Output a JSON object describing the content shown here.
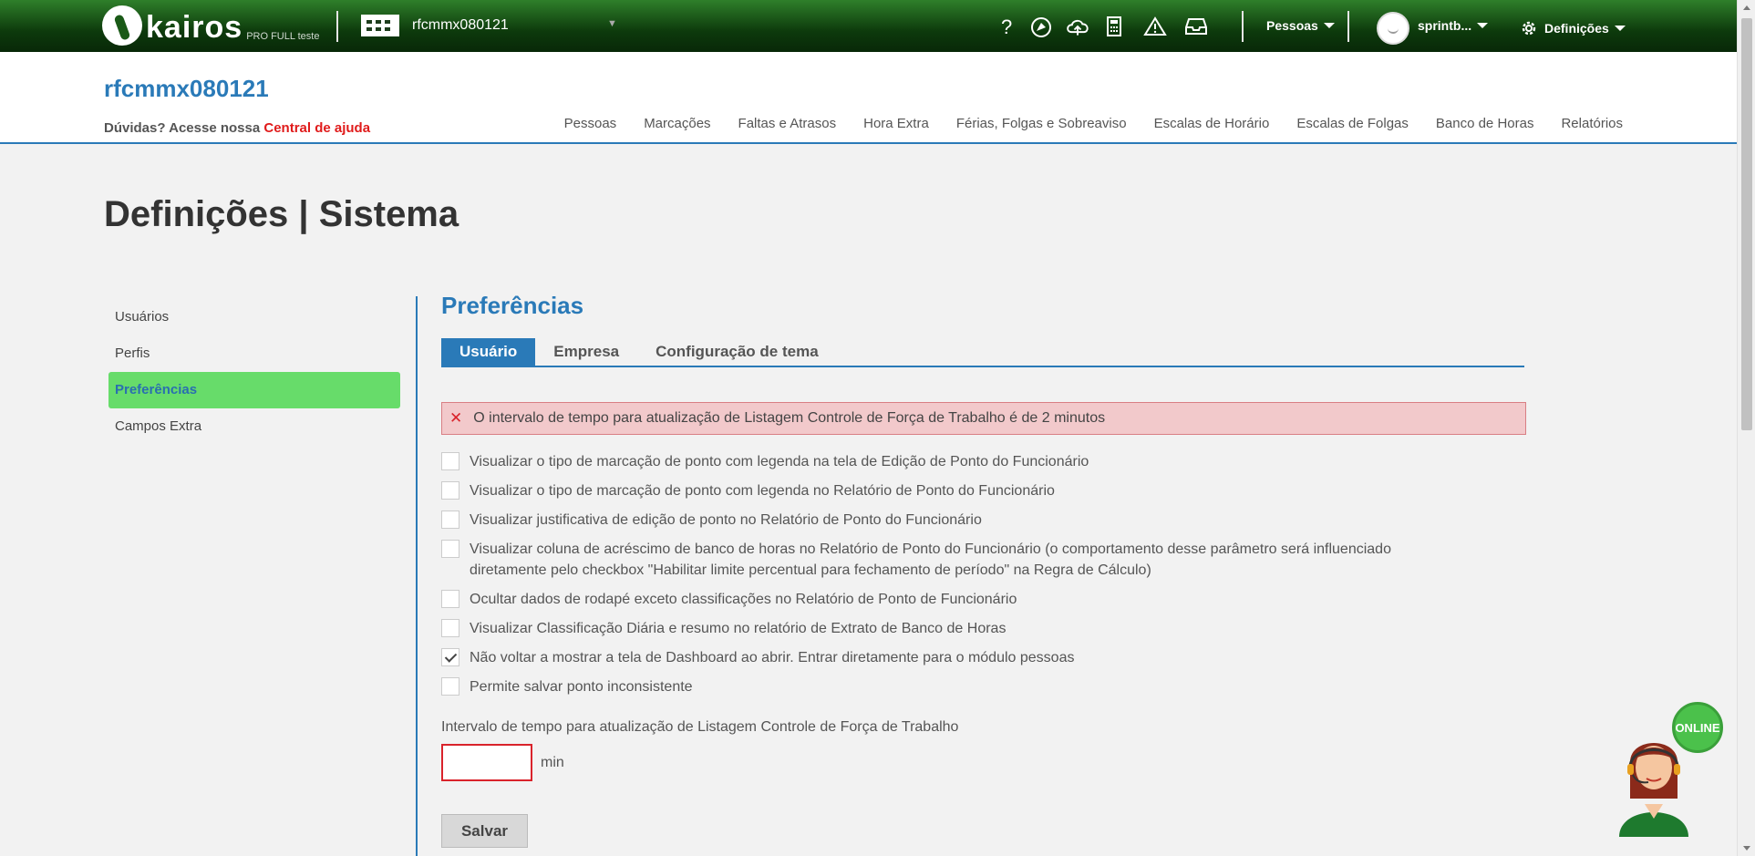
{
  "topbar": {
    "logo_text": "kairos",
    "logo_subtitle": "PRO FULL teste",
    "company": "rfcmmx080121",
    "people_menu": "Pessoas",
    "user_menu": "sprintb...",
    "settings_menu": "Definições",
    "icons": [
      "help-icon",
      "rocket-icon",
      "cloud-upload-icon",
      "calculator-icon",
      "warning-icon",
      "inbox-icon"
    ]
  },
  "header": {
    "company_title": "rfcmmx080121",
    "help_prefix": "Dúvidas? Acesse nossa ",
    "help_link": "Central de ajuda",
    "nav": [
      "Pessoas",
      "Marcações",
      "Faltas e Atrasos",
      "Hora Extra",
      "Férias, Folgas e Sobreaviso",
      "Escalas de Horário",
      "Escalas de Folgas",
      "Banco de Horas",
      "Relatórios"
    ]
  },
  "page": {
    "title": "Definições | Sistema"
  },
  "sidemenu": {
    "items": [
      "Usuários",
      "Perfis",
      "Preferências",
      "Campos Extra"
    ],
    "active_index": 2
  },
  "content": {
    "section_title": "Preferências",
    "tabs": [
      "Usuário",
      "Empresa",
      "Configuração de tema"
    ],
    "active_tab": 0,
    "error_message": "O intervalo de tempo para atualização de Listagem Controle de Força de Trabalho é de 2 minutos",
    "options": [
      {
        "label": "Visualizar o tipo de marcação de ponto com legenda na tela de Edição de Ponto do Funcionário",
        "checked": false
      },
      {
        "label": "Visualizar o tipo de marcação de ponto com legenda no Relatório de Ponto do Funcionário",
        "checked": false
      },
      {
        "label": "Visualizar justificativa de edição de ponto no Relatório de Ponto do Funcionário",
        "checked": false
      },
      {
        "label": "Visualizar coluna de acréscimo de banco de horas no Relatório de Ponto do Funcionário (o comportamento desse parâmetro será influenciado diretamente pelo checkbox \"Habilitar limite percentual para fechamento de período\" na Regra de Cálculo)",
        "checked": false
      },
      {
        "label": "Ocultar dados de rodapé exceto classificações no Relatório de Ponto de Funcionário",
        "checked": false
      },
      {
        "label": "Visualizar Classificação Diária e resumo no relatório de Extrato de Banco de Horas",
        "checked": false
      },
      {
        "label": "Não voltar a mostrar a tela de Dashboard ao abrir. Entrar diretamente para o módulo pessoas",
        "checked": true
      },
      {
        "label": "Permite salvar ponto inconsistente",
        "checked": false
      }
    ],
    "interval_label": "Intervalo de tempo para atualização de Listagem Controle de Força de Trabalho",
    "interval_value": "",
    "interval_unit": "min",
    "save_label": "Salvar"
  },
  "widget": {
    "online_label": "ONLINE"
  },
  "colors": {
    "accent_blue": "#2a7ab8",
    "active_green": "#67dc6a",
    "error_red": "#d9232b",
    "error_bg": "#f2c9cb"
  }
}
